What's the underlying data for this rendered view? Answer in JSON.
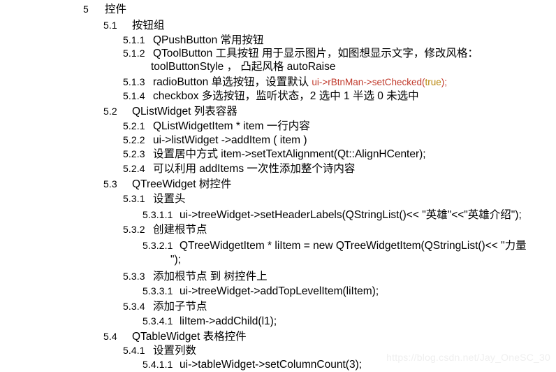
{
  "document": {
    "watermark": "https://blog.csdn.net/Jay_OneSC_30",
    "lines": [
      {
        "id": "l0",
        "level": 1,
        "number": "5",
        "text": "控件"
      },
      {
        "id": "l1",
        "level": 2,
        "number": "5.1",
        "text": "按钮组"
      },
      {
        "id": "l2",
        "level": 3,
        "number": "5.1.1",
        "text": "QPushButton   常用按钮"
      },
      {
        "id": "l3",
        "level": 3,
        "number": "5.1.2",
        "text": "QToolButton   工具按钮   用于显示图片，如图想显示文字，修改风格："
      },
      {
        "id": "l4",
        "level": 0,
        "cont": 3,
        "text": "toolButtonStyle ，  凸起风格 autoRaise"
      },
      {
        "id": "l5",
        "level": 3,
        "number": "5.1.3",
        "text": "radioButton  单选按钮，设置默认 ",
        "code": "ui->rBtnMan->setChecked(",
        "code_arg": "true",
        "code_tail": ");"
      },
      {
        "id": "l6",
        "level": 3,
        "number": "5.1.4",
        "text": "checkbox 多选按钮，监听状态，2 选中 1 半选 0 未选中"
      },
      {
        "id": "l7",
        "level": 2,
        "number": "5.2",
        "text": "QListWidget 列表容器"
      },
      {
        "id": "l8",
        "level": 3,
        "number": "5.2.1",
        "text": "QListWidgetItem * item  一行内容"
      },
      {
        "id": "l9",
        "level": 3,
        "number": "5.2.2",
        "text": "ui->listWidget ->addItem ( item )"
      },
      {
        "id": "l10",
        "level": 3,
        "number": "5.2.3",
        "text": "设置居中方式 item->setTextAlignment(Qt::AlignHCenter);"
      },
      {
        "id": "l11",
        "level": 3,
        "number": "5.2.4",
        "text": "可以利用 addItems 一次性添加整个诗内容"
      },
      {
        "id": "l12",
        "level": 2,
        "number": "5.3",
        "text": "QTreeWidget 树控件"
      },
      {
        "id": "l13",
        "level": 3,
        "number": "5.3.1",
        "text": "设置头"
      },
      {
        "id": "l14",
        "level": 4,
        "number": "5.3.1.1",
        "text": "ui->treeWidget->setHeaderLabels(QStringList()<< \"英雄\"<<\"英雄介绍\");"
      },
      {
        "id": "l15",
        "level": 3,
        "number": "5.3.2",
        "text": "创建根节点"
      },
      {
        "id": "l16",
        "level": 4,
        "number": "5.3.2.1",
        "text": "QTreeWidgetItem * liItem = new QTreeWidgetItem(QStringList()<< \"力量"
      },
      {
        "id": "l17",
        "level": 0,
        "cont": 4,
        "text": "\");"
      },
      {
        "id": "l18",
        "level": 3,
        "number": "5.3.3",
        "text": "添加根节点 到 树控件上"
      },
      {
        "id": "l19",
        "level": 4,
        "number": "5.3.3.1",
        "text": "ui->treeWidget->addTopLevelItem(liItem);"
      },
      {
        "id": "l20",
        "level": 3,
        "number": "5.3.4",
        "text": "添加子节点"
      },
      {
        "id": "l21",
        "level": 4,
        "number": "5.3.4.1",
        "text": "liItem->addChild(l1);"
      },
      {
        "id": "l22",
        "level": 2,
        "number": "5.4",
        "text": "QTableWidget 表格控件"
      },
      {
        "id": "l23",
        "level": 3,
        "number": "5.4.1",
        "text": "设置列数"
      },
      {
        "id": "l24",
        "level": 4,
        "number": "5.4.1.1",
        "text": "ui->tableWidget->setColumnCount(3);"
      }
    ]
  },
  "colors": {
    "text": "#000000",
    "code_red": "#c0392b",
    "code_gold": "#b8860b",
    "watermark": "#efefef",
    "background": "#ffffff"
  }
}
